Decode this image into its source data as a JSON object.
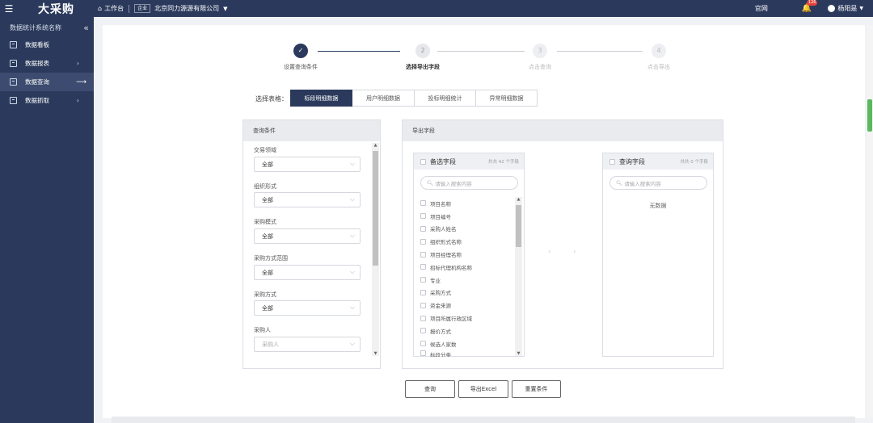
{
  "topbar": {
    "logo": "大采购",
    "home_label": "工作台",
    "enterprise_badge": "企业",
    "company": "北京同力源源有限公司",
    "official_site": "官网",
    "notification_count": "126",
    "user_name": "杨阳是"
  },
  "sidebar": {
    "system_title": "数据统计系统名称",
    "items": [
      {
        "label": "数据看板"
      },
      {
        "label": "数据报表"
      },
      {
        "label": "数据查询"
      },
      {
        "label": "数据抓取"
      }
    ]
  },
  "steps": [
    {
      "number": "✓",
      "label": "设置查询条件",
      "state": "done"
    },
    {
      "number": "2",
      "label": "选择导出字段",
      "state": "current"
    },
    {
      "number": "3",
      "label": "点击查询",
      "state": "pending"
    },
    {
      "number": "4",
      "label": "点击导出",
      "state": "pending"
    }
  ],
  "table_selector": {
    "label": "选择表格：",
    "tabs": [
      "标段明细数据",
      "用户明细数据",
      "投标明细统计",
      "异常明细数据"
    ],
    "selected": "标段明细数据"
  },
  "conditions": {
    "title": "查询条件",
    "fields": [
      {
        "label": "交易领域",
        "value": "全部"
      },
      {
        "label": "组织形式",
        "value": "全部"
      },
      {
        "label": "采购模式",
        "value": "全部"
      },
      {
        "label": "采购方式范围",
        "value": "全部"
      },
      {
        "label": "采购方式",
        "value": "全部"
      },
      {
        "label": "采购人",
        "placeholder": "采购人"
      }
    ]
  },
  "export_fields": {
    "title": "导出字段",
    "available": {
      "title": "备选字段",
      "count": "共共 42 个字段",
      "search_placeholder": "请输入搜索内容",
      "items": [
        "项目名称",
        "项目编号",
        "采购人姓名",
        "组织形式名称",
        "项目经理名称",
        "招标代理机构名称",
        "专业",
        "采购方式",
        "资金来源",
        "项目所属行政区域",
        "报价方式",
        "候选人家数",
        "标段分类"
      ]
    },
    "selected": {
      "title": "查询字段",
      "count": "共共 0 个字段",
      "search_placeholder": "请输入搜索内容",
      "empty_text": "无数据"
    }
  },
  "actions": {
    "query": "查询",
    "export_excel": "导出Excel",
    "reset": "重置条件"
  },
  "colors": {
    "nav_bg": "#2b3a5c",
    "accent": "#2b3a5c",
    "badge_red": "#e8433a"
  }
}
